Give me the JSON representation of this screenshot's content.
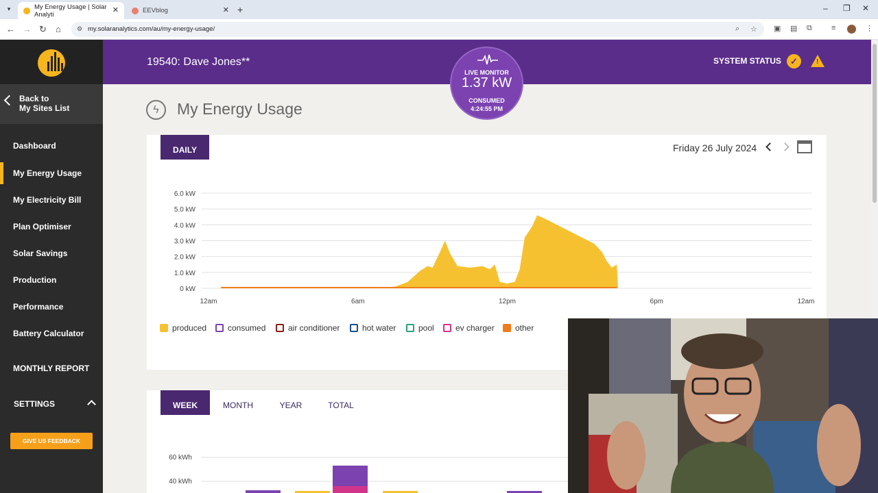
{
  "browser": {
    "tabs": [
      {
        "title": "My Energy Usage | Solar Analyti",
        "active": true
      },
      {
        "title": "EEVblog",
        "active": false
      }
    ],
    "url": "my.solaranalytics.com/au/my-energy-usage/"
  },
  "sidebar": {
    "back_label_1": "Back to",
    "back_label_2": "My Sites List",
    "items": [
      {
        "label": "Dashboard"
      },
      {
        "label": "My Energy Usage",
        "active": true
      },
      {
        "label": "My Electricity Bill"
      },
      {
        "label": "Plan Optimiser"
      },
      {
        "label": "Solar Savings"
      },
      {
        "label": "Production"
      },
      {
        "label": "Performance"
      },
      {
        "label": "Battery Calculator"
      }
    ],
    "monthly_report": "MONTHLY REPORT",
    "settings": "SETTINGS",
    "feedback": "GIVE US FEEDBACK"
  },
  "header": {
    "site_name": "19540: Dave Jones**",
    "system_status": "SYSTEM STATUS"
  },
  "live_monitor": {
    "label": "LIVE MONITOR",
    "value": "1.37 kW",
    "state": "CONSUMED",
    "time": "4:24:55 PM"
  },
  "page": {
    "title": "My Energy Usage"
  },
  "daily": {
    "tab": "DAILY",
    "date": "Friday 26 July 2024"
  },
  "legend": [
    {
      "label": "produced",
      "color": "#f6c131",
      "filled": true
    },
    {
      "label": "consumed",
      "color": "#7b42b0",
      "filled": false
    },
    {
      "label": "air conditioner",
      "color": "#8b1a1a",
      "filled": false
    },
    {
      "label": "hot water",
      "color": "#1a4f8a",
      "filled": false
    },
    {
      "label": "pool",
      "color": "#2aa07a",
      "filled": false
    },
    {
      "label": "ev charger",
      "color": "#d0358a",
      "filled": false
    },
    {
      "label": "other",
      "color": "#f07d1a",
      "filled": true
    }
  ],
  "period_tabs": [
    {
      "label": "WEEK",
      "selected": true
    },
    {
      "label": "MONTH"
    },
    {
      "label": "YEAR"
    },
    {
      "label": "TOTAL"
    }
  ],
  "chart_data": [
    {
      "type": "area",
      "series": [
        {
          "name": "produced",
          "x": [
            0,
            6.5,
            7.0,
            7.5,
            8.0,
            8.5,
            8.8,
            9.0,
            9.3,
            9.5,
            9.7,
            10.0,
            10.5,
            11.0,
            11.3,
            11.5,
            11.7,
            12.0,
            12.3,
            12.5,
            12.7,
            13.0,
            13.2,
            13.5,
            14.0,
            14.5,
            15.0,
            15.5,
            15.8,
            16.0,
            16.2,
            16.4,
            16.45,
            24
          ],
          "y": [
            0,
            0,
            0.05,
            0.1,
            0.4,
            1.1,
            1.4,
            1.3,
            2.3,
            3.0,
            2.2,
            1.4,
            1.3,
            1.4,
            1.2,
            1.5,
            0.4,
            0.3,
            0.4,
            1.2,
            3.2,
            3.9,
            4.6,
            4.4,
            4.0,
            3.6,
            3.2,
            2.8,
            2.3,
            1.7,
            1.3,
            1.5,
            0,
            0
          ]
        }
      ],
      "xticks": [
        "12am",
        "6am",
        "12pm",
        "6pm",
        "12am"
      ],
      "yticks": [
        "0 kW",
        "1.0 kW",
        "2.0 kW",
        "3.0 kW",
        "4.0 kW",
        "5.0 kW",
        "6.0 kW"
      ],
      "xlim": [
        0,
        24
      ],
      "ylim": [
        0,
        6
      ],
      "grid": true
    },
    {
      "type": "bar",
      "yticks": [
        "40 kWh",
        "60 kWh"
      ]
    }
  ]
}
